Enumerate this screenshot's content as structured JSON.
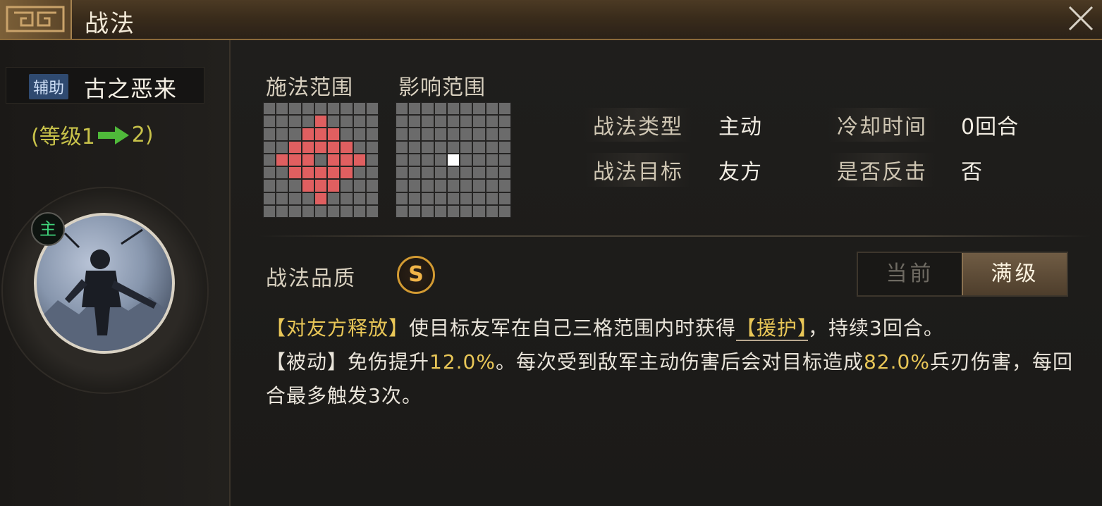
{
  "header": {
    "title": "战法"
  },
  "hero": {
    "tag": "辅助",
    "name": "古之恶来",
    "level_prefix": "(等级1",
    "level_suffix": "2)",
    "badge": "主"
  },
  "range": {
    "cast_label": "施法范围",
    "effect_label": "影响范围"
  },
  "stats": {
    "type_label": "战法类型",
    "type_value": "主动",
    "cooldown_label": "冷却时间",
    "cooldown_value": "0回合",
    "target_label": "战法目标",
    "target_value": "友方",
    "counter_label": "是否反击",
    "counter_value": "否"
  },
  "quality": {
    "label": "战法品质",
    "grade": "S"
  },
  "toggle": {
    "current": "当前",
    "max": "满级"
  },
  "description": {
    "p1": "【对友方释放】",
    "p2": "使目标友军在自己三格范围内时获得",
    "p3": "【援护】",
    "p4": "，持续3回合。",
    "p5": "【被动】免伤提升",
    "p6": "12.0%",
    "p7": "。每次受到敌军主动伤害后会对目标造成",
    "p8": "82.0%",
    "p9": "兵刃伤害，每回合最多触发3次。"
  },
  "colors": {
    "accent_gold": "#e8c657",
    "range_red": "#e05f60",
    "tag_blue": "#2f4a70",
    "badge_green": "#3fd27a"
  },
  "icons": {
    "close": "close-icon",
    "arrow": "arrow-right-icon",
    "ornament": "corner-ornament-icon"
  }
}
